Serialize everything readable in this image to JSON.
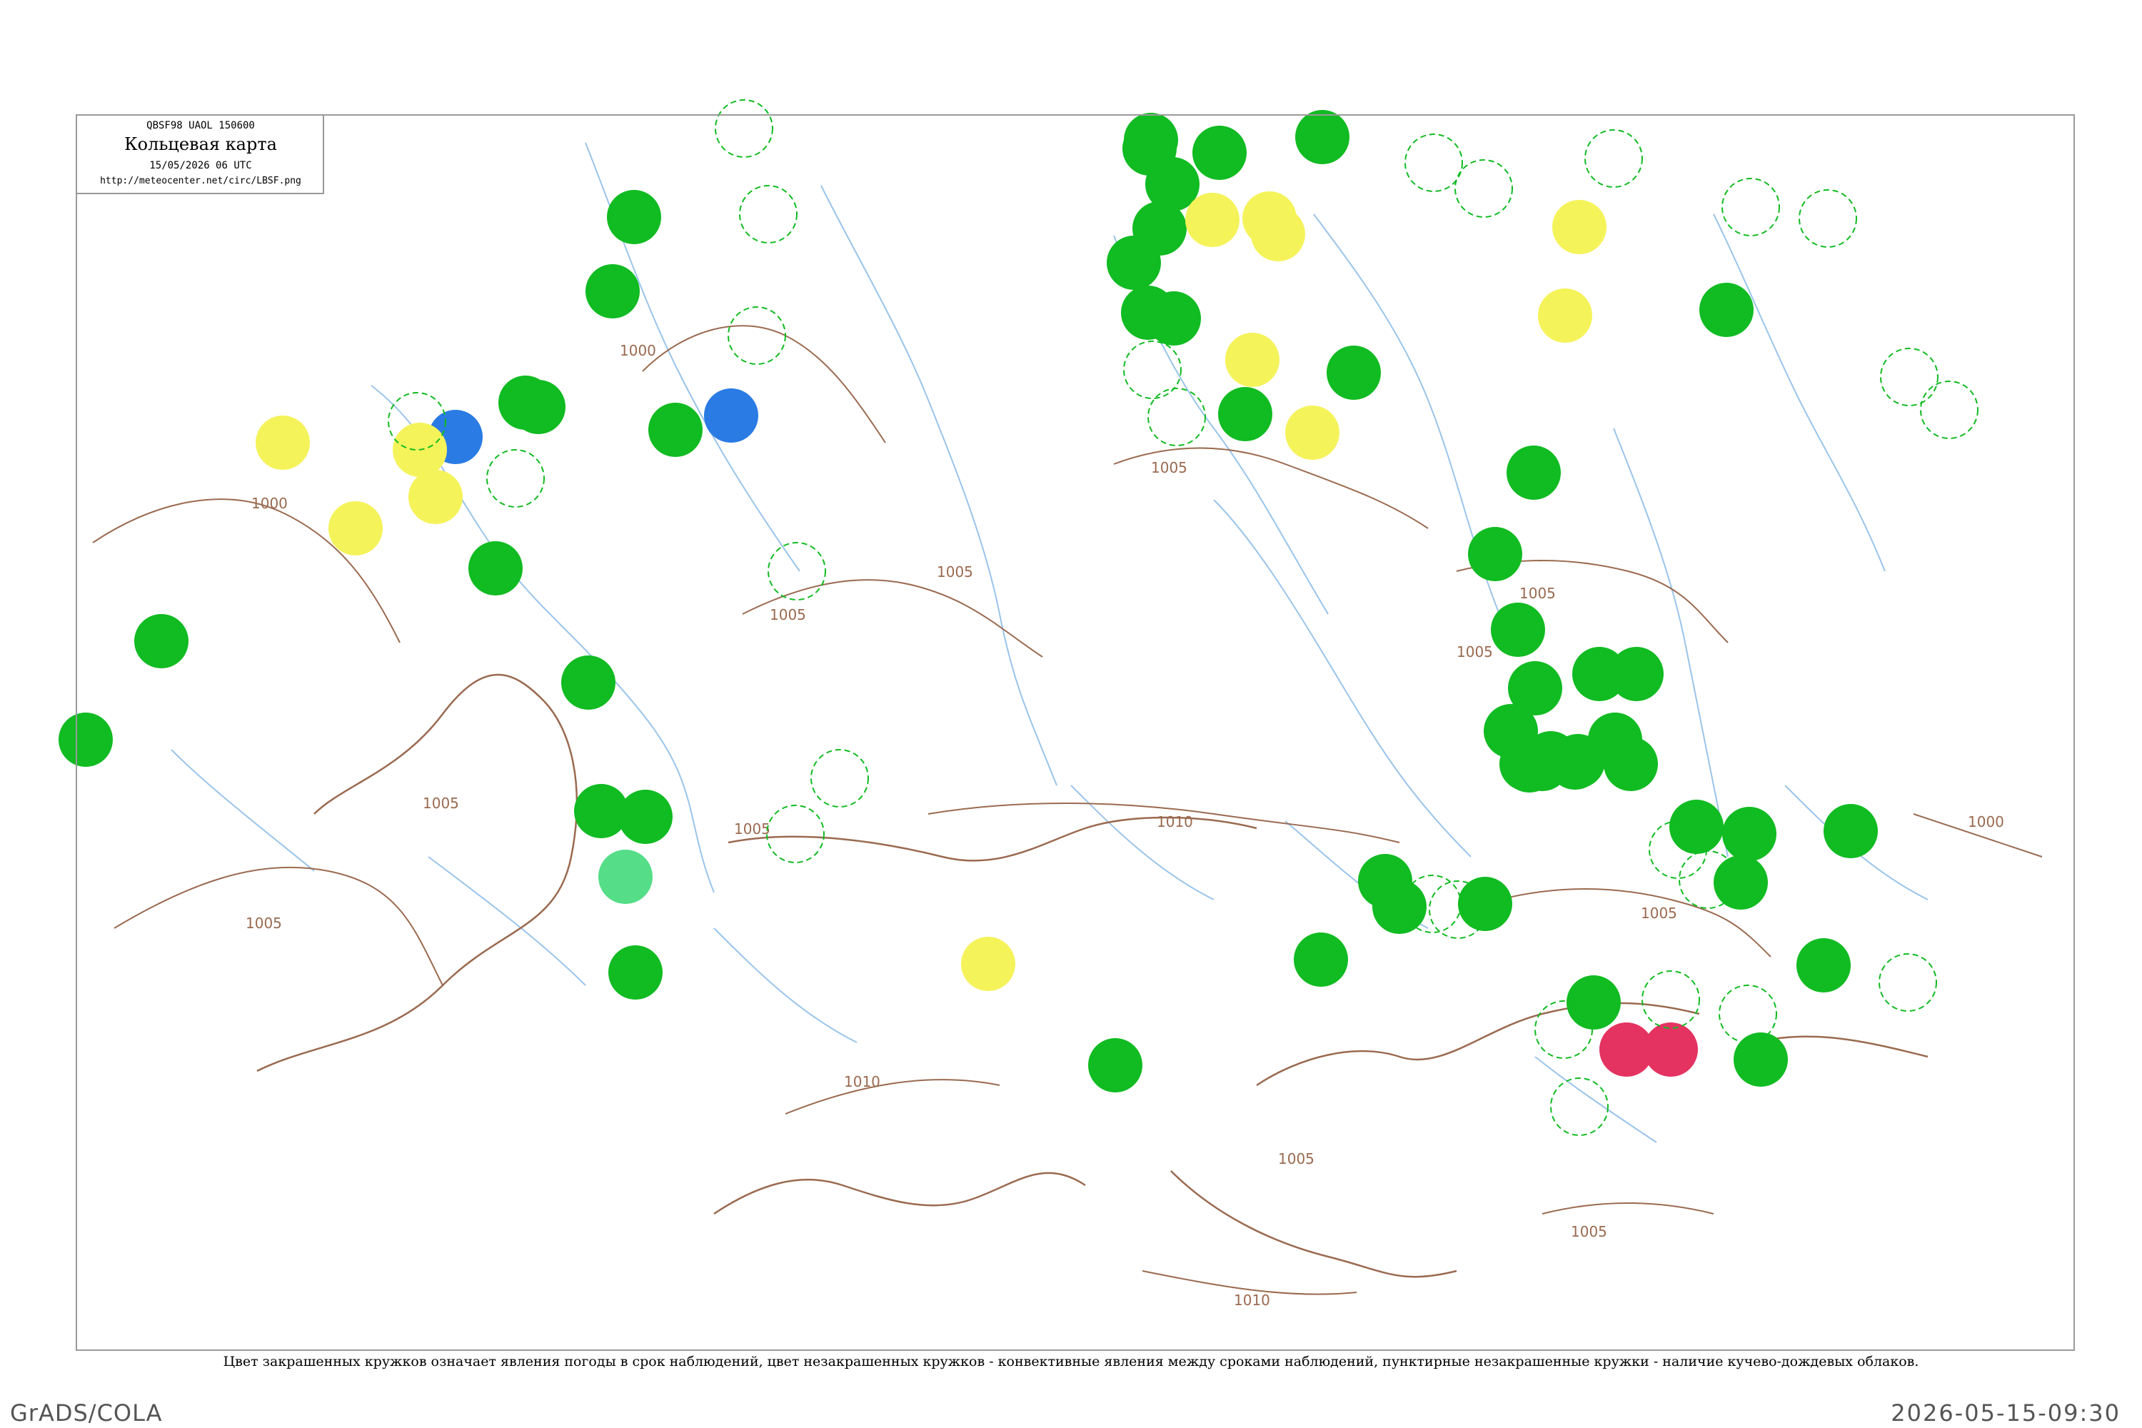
{
  "title_box": {
    "header_line": "QBSF98  UAOL  150600",
    "title": "Кольцевая карта",
    "datetime": "15/05/2026 06 UTC",
    "url": "http://meteocenter.net/circ/LBSF.png"
  },
  "isobar_labels": [
    {
      "text": "1000"
    },
    {
      "text": "1000"
    },
    {
      "text": "1005"
    },
    {
      "text": "1005"
    },
    {
      "text": "1005"
    },
    {
      "text": "1005"
    },
    {
      "text": "1005"
    },
    {
      "text": "1005"
    },
    {
      "text": "1005"
    },
    {
      "text": "1005"
    },
    {
      "text": "1005"
    },
    {
      "text": "1005"
    },
    {
      "text": "1010"
    },
    {
      "text": "1010"
    },
    {
      "text": "1010"
    },
    {
      "text": "1000"
    },
    {
      "text": "1005"
    }
  ],
  "colors": {
    "green_marker": "#11bb22",
    "yellow_marker": "#f5f35a",
    "blue_marker": "#2a7be4",
    "red_marker": "#e43361",
    "light_green_marker": "#55dd88",
    "isobar": "#9a6a50",
    "river": "#9ac4ea",
    "frame": "#9a9a9a"
  },
  "caption": "Цвет закрашенных кружков означает явления погоды в срок наблюдений, цвет незакрашенных кружков - конвективные явления между сроками наблюдений, пунктирные незакрашенные кружки - наличие кучево-дождевых облаков.",
  "footer": {
    "left": "GrADS/COLA",
    "right": "2026-05-15-09:30"
  }
}
